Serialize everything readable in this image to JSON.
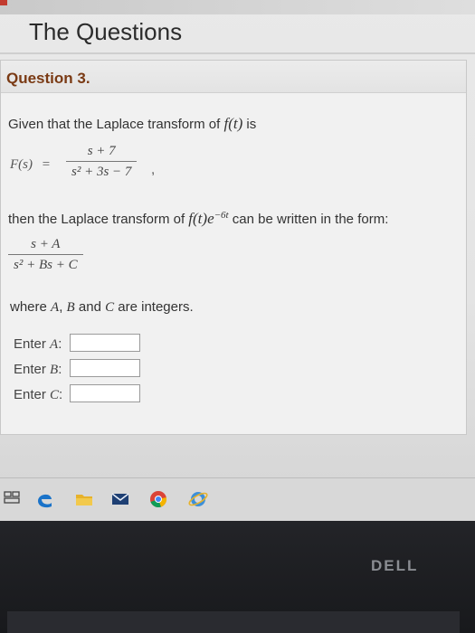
{
  "app": {
    "title": "The Questions"
  },
  "question": {
    "label": "Question 3.",
    "intro_before": "Given that the Laplace transform of ",
    "f_t": "f(t)",
    "intro_after": " is",
    "Fs_lhs": "F(s)",
    "equals": "=",
    "Fs_num": "s + 7",
    "Fs_den": "s² + 3s − 7",
    "comma": ",",
    "then_before": "then the Laplace transform of ",
    "then_fe": "f(t)e",
    "exponent": "−6t",
    "then_after": " can be written in the form:",
    "form_num": "s + A",
    "form_den": "s² + Bs + C",
    "where_before": "where ",
    "var_a": "A",
    "where_comma": ",",
    "var_b": "B",
    "where_and": " and ",
    "var_c": "C",
    "where_after": " are integers."
  },
  "inputs": [
    {
      "label_prefix": "Enter ",
      "var": "A",
      "suffix": ":",
      "value": ""
    },
    {
      "label_prefix": "Enter ",
      "var": "B",
      "suffix": ":",
      "value": ""
    },
    {
      "label_prefix": "Enter ",
      "var": "C",
      "suffix": ":",
      "value": ""
    }
  ],
  "taskbar": {
    "icons": [
      "task-view-icon",
      "edge-icon",
      "file-explorer-icon",
      "mail-icon",
      "chrome-icon",
      "internet-explorer-icon"
    ],
    "colors": {
      "edge": "#1a73c9",
      "explorer": "#e7b22b",
      "chrome_red": "#db4437",
      "chrome_yellow": "#f4b400",
      "chrome_green": "#0f9d58",
      "ie": "#3c8fd9"
    }
  },
  "device": {
    "logo": "DELL"
  }
}
